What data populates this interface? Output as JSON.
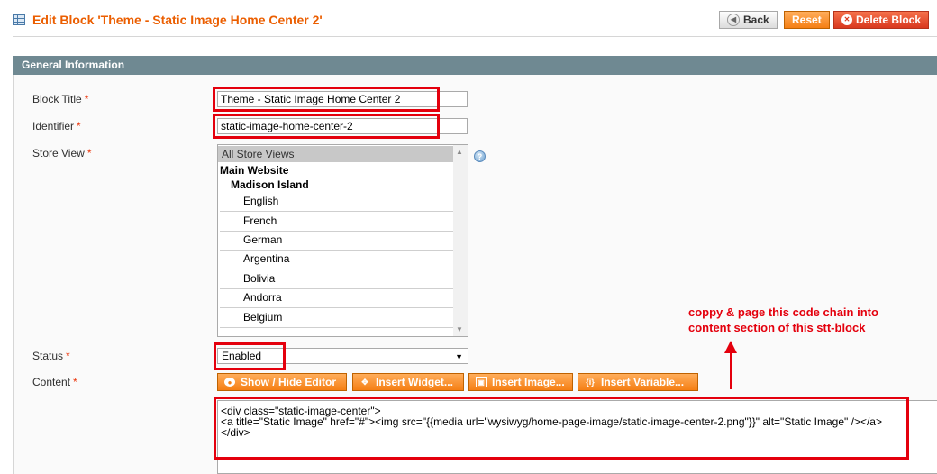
{
  "header": {
    "title": "Edit Block 'Theme - Static Image Home Center 2'",
    "back_label": "Back",
    "reset_label": "Reset",
    "delete_label": "Delete Block"
  },
  "section": {
    "title": "General Information"
  },
  "form": {
    "block_title_label": "Block Title",
    "block_title_value": "Theme - Static Image Home Center 2",
    "identifier_label": "Identifier",
    "identifier_value": "static-image-home-center-2",
    "store_view_label": "Store View",
    "store_view_options": [
      "All Store Views",
      "Main Website",
      "Madison Island",
      "English",
      "French",
      "German",
      "Argentina",
      "Bolivia",
      "Andorra",
      "Belgium"
    ],
    "store_view_selected": "All Store Views",
    "status_label": "Status",
    "status_value": "Enabled",
    "content_label": "Content",
    "required_mark": "*"
  },
  "toolbar": {
    "show_hide_label": "Show / Hide Editor",
    "insert_widget_label": "Insert Widget...",
    "insert_image_label": "Insert Image...",
    "insert_variable_label": "Insert Variable..."
  },
  "content": {
    "lines": [
      "<div class=\"static-image-center\">",
      "<a title=\"Static Image\" href=\"#\"><img src=\"{{media url=\"wysiwyg/home-page-image/static-image-center-2.png\"}}\" alt=\"Static Image\" /></a>",
      "</div>"
    ]
  },
  "annotation": {
    "line1": "coppy & page this code chain into",
    "line2": "content section of this stt-block"
  },
  "colors": {
    "accent_orange": "#f57f14",
    "title_orange": "#eb5e00",
    "section_header": "#6f8992",
    "annotation_red": "#e4000d"
  }
}
